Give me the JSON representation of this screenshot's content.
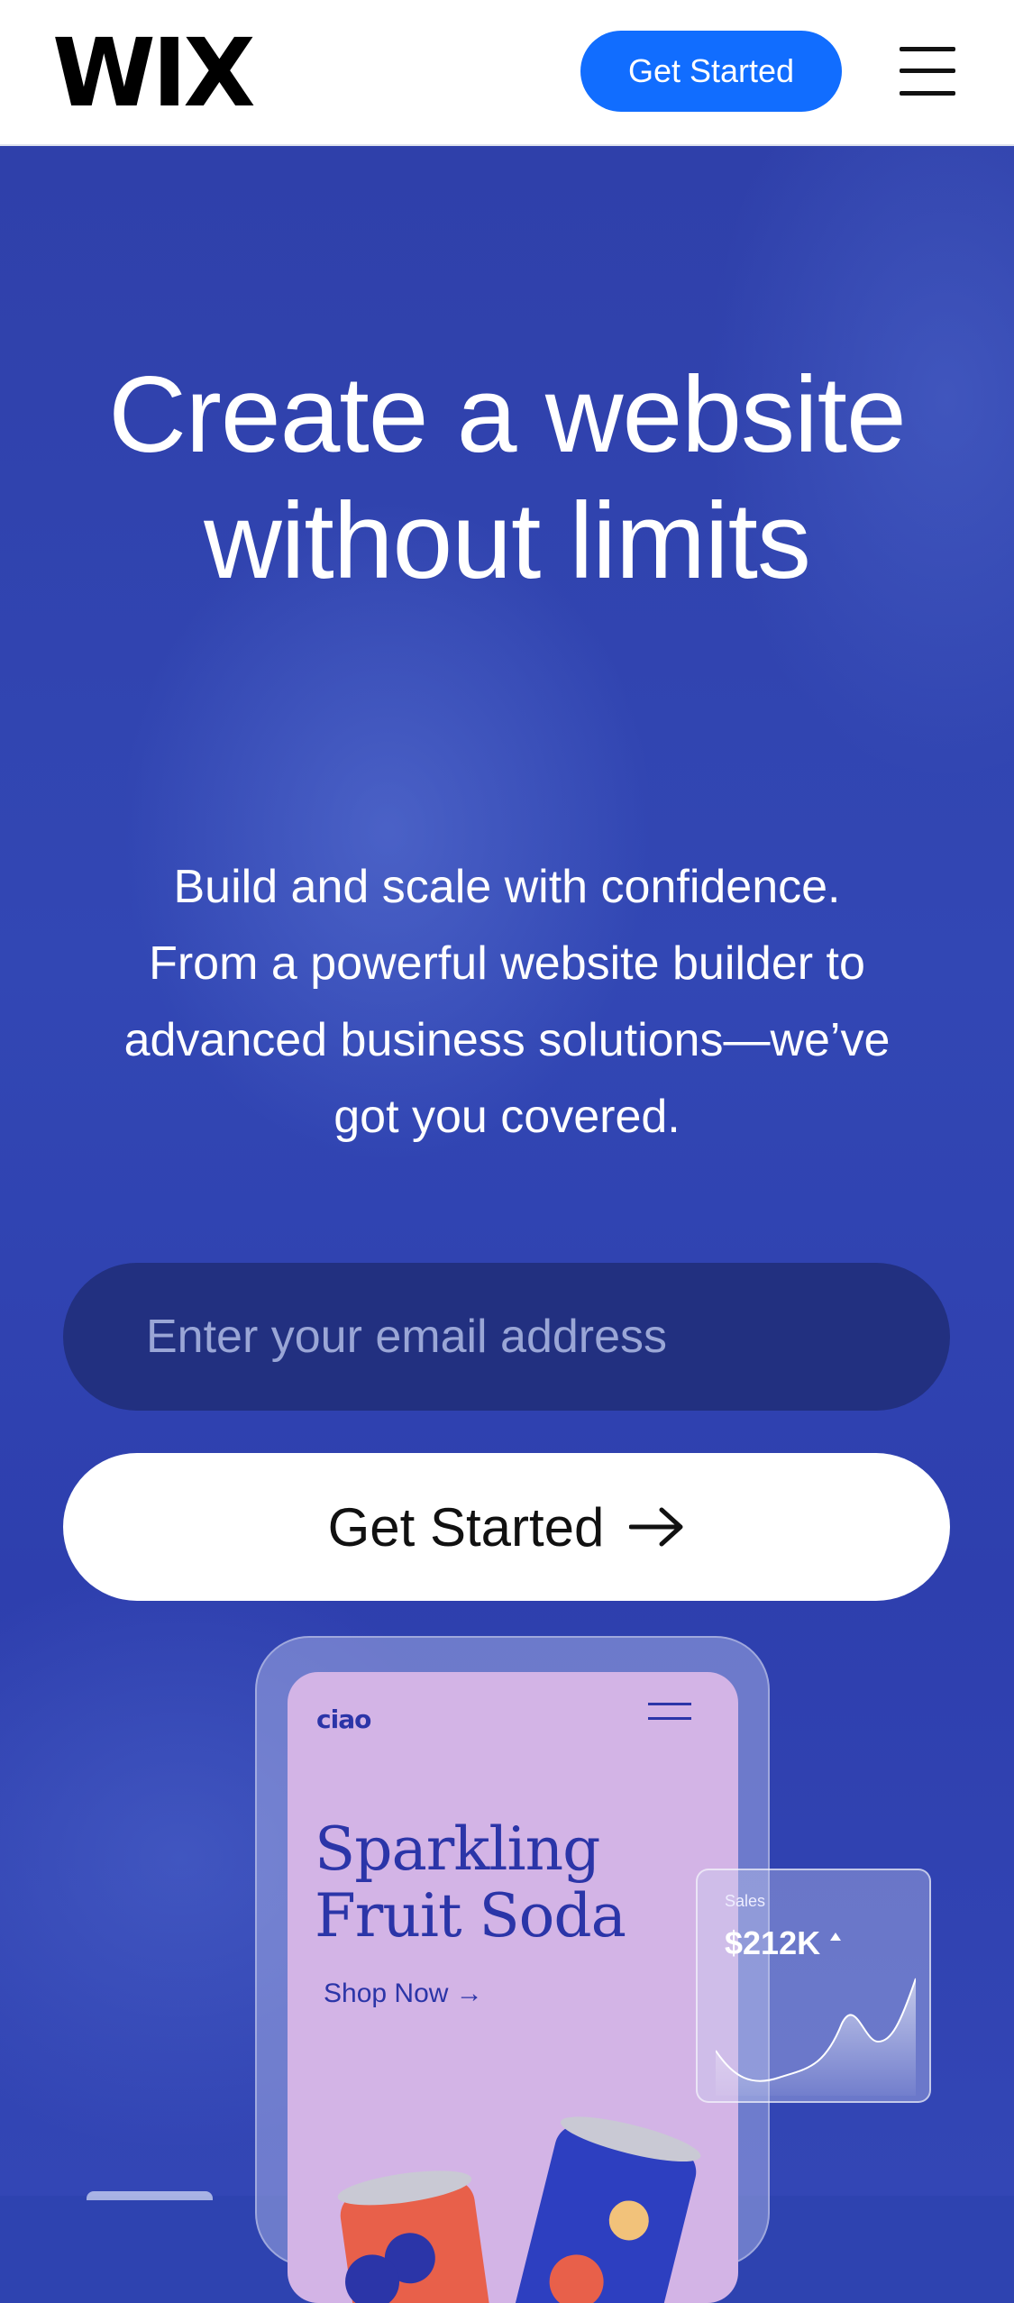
{
  "header": {
    "logo": "WIX",
    "cta_label": "Get Started",
    "menu_icon": "hamburger-menu-icon"
  },
  "hero": {
    "title_line1": "Create a website",
    "title_line2": "without limits",
    "subtitle_lines": [
      "Build and scale with confidence.",
      "From a powerful website builder to",
      "advanced business solutions—we’ve",
      "got you covered."
    ],
    "email_placeholder": "Enter your email address",
    "cta_label": "Get Started",
    "cta_icon": "arrow-right-icon"
  },
  "mockup": {
    "brand": "ciao",
    "headline_line1": "Sparkling",
    "headline_line2": "Fruit Soda",
    "shop_label": "Shop Now →",
    "sales_card": {
      "label": "Sales",
      "value": "$212K",
      "trend_icon": "caret-up-icon"
    }
  },
  "colors": {
    "brand_blue": "#116dff",
    "hero_background": "#2e43b0",
    "email_field": "#223080",
    "mockup_screen": "#d3b4e6",
    "mockup_text": "#2b35a8"
  }
}
